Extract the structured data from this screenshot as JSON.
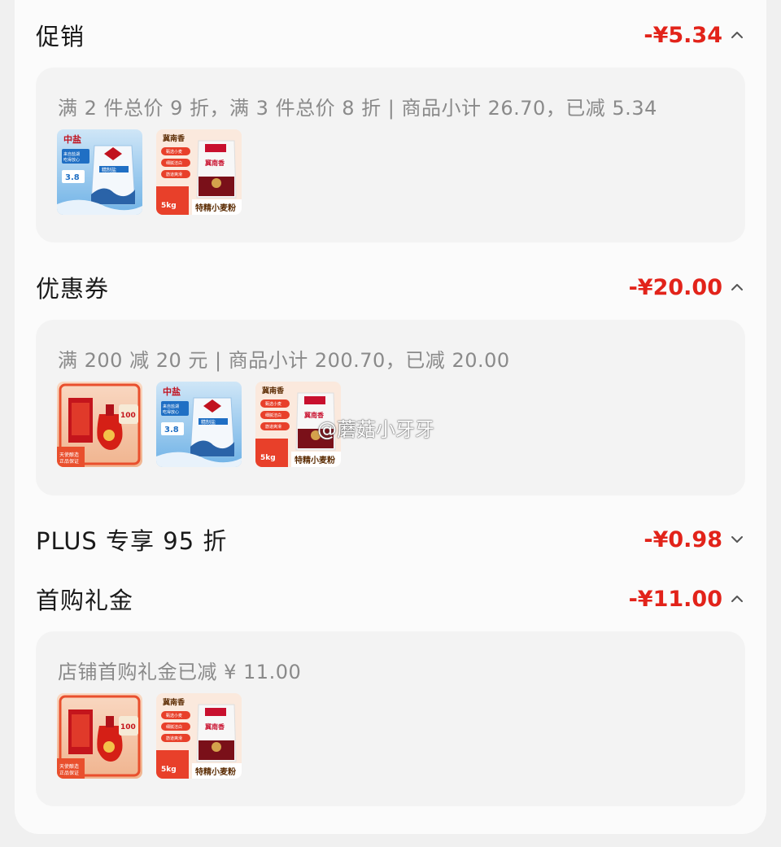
{
  "sections": [
    {
      "title": "促销",
      "amount": "-¥5.34",
      "expanded": true,
      "desc": "满 2 件总价 9 折，满 3 件总价 8 折 | 商品小计 26.70，已减 5.34",
      "products": [
        "rice",
        "flour"
      ]
    },
    {
      "title": "优惠券",
      "amount": "-¥20.00",
      "expanded": true,
      "desc": "满 200 减 20 元 | 商品小计 200.70，已减 20.00",
      "products": [
        "liquor",
        "rice",
        "flour"
      ]
    },
    {
      "title": "PLUS 专享 95 折",
      "amount": "-¥0.98",
      "expanded": false
    },
    {
      "title": "首购礼金",
      "amount": "-¥11.00",
      "expanded": true,
      "desc": "店铺首购礼金已减 ¥ 11.00",
      "products": [
        "liquor",
        "flour"
      ]
    }
  ],
  "product_labels": {
    "rice_brand": "中盐",
    "rice_tagline": "来自盐湖 吃得放心",
    "rice_price": "3.8",
    "rice_bag_text": "精制盐",
    "flour_brand": "冀南香",
    "flour_tags": [
      "甄选小麦",
      "细腻洁白",
      "筋道爽滑"
    ],
    "flour_weight": "5kg",
    "flour_name": "特精小麦粉",
    "flour_bag_text": "冀南香",
    "liquor_badge": "100",
    "liquor_tag": "天使酿造 正品保证"
  },
  "watermark": "@蘑菇小牙牙",
  "icons": {
    "expanded": "chevron-up-icon",
    "collapsed": "chevron-down-icon"
  },
  "colors": {
    "amount": "#e2231a",
    "title": "#1a1a1a",
    "desc": "#8a8a8a"
  }
}
